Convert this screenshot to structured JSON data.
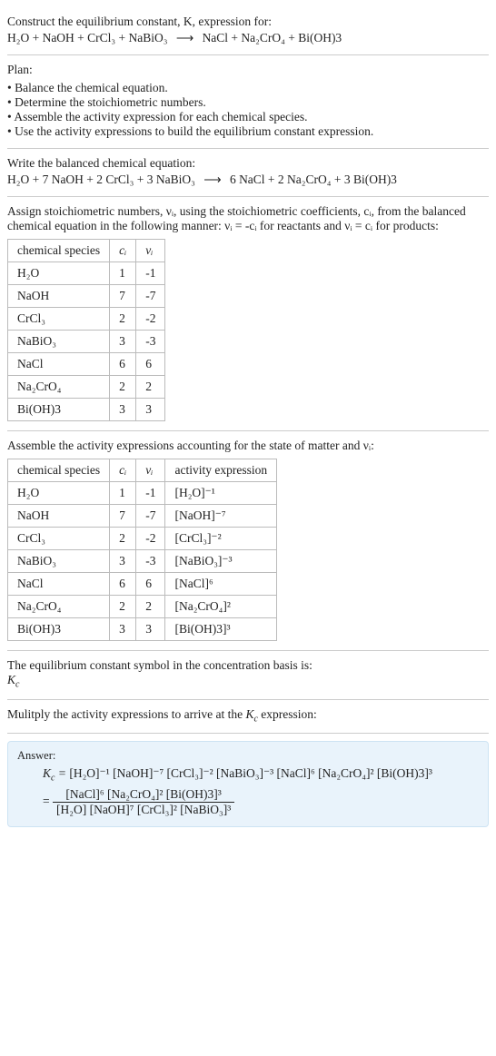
{
  "intro": {
    "line1": "Construct the equilibrium constant, K, expression for:",
    "reaction_lhs": "H₂O + NaOH + CrCl₃ + NaBiO₃",
    "arrow": "⟶",
    "reaction_rhs": "NaCl + Na₂CrO₄ + Bi(OH)3"
  },
  "plan": {
    "title": "Plan:",
    "items": [
      "Balance the chemical equation.",
      "Determine the stoichiometric numbers.",
      "Assemble the activity expression for each chemical species.",
      "Use the activity expressions to build the equilibrium constant expression."
    ]
  },
  "balanced": {
    "title": "Write the balanced chemical equation:",
    "lhs": "H₂O + 7 NaOH + 2 CrCl₃ + 3 NaBiO₃",
    "arrow": "⟶",
    "rhs": "6 NaCl + 2 Na₂CrO₄ + 3 Bi(OH)3"
  },
  "stoich": {
    "intro1": "Assign stoichiometric numbers, νᵢ, using the stoichiometric coefficients, cᵢ, from the balanced chemical equation in the following manner: νᵢ = -cᵢ for reactants and νᵢ = cᵢ for products:",
    "headers": [
      "chemical species",
      "cᵢ",
      "νᵢ"
    ],
    "rows": [
      {
        "s": "H₂O",
        "c": "1",
        "v": "-1"
      },
      {
        "s": "NaOH",
        "c": "7",
        "v": "-7"
      },
      {
        "s": "CrCl₃",
        "c": "2",
        "v": "-2"
      },
      {
        "s": "NaBiO₃",
        "c": "3",
        "v": "-3"
      },
      {
        "s": "NaCl",
        "c": "6",
        "v": "6"
      },
      {
        "s": "Na₂CrO₄",
        "c": "2",
        "v": "2"
      },
      {
        "s": "Bi(OH)3",
        "c": "3",
        "v": "3"
      }
    ]
  },
  "activity": {
    "intro": "Assemble the activity expressions accounting for the state of matter and νᵢ:",
    "headers": [
      "chemical species",
      "cᵢ",
      "νᵢ",
      "activity expression"
    ],
    "rows": [
      {
        "s": "H₂O",
        "c": "1",
        "v": "-1",
        "a": "[H₂O]⁻¹"
      },
      {
        "s": "NaOH",
        "c": "7",
        "v": "-7",
        "a": "[NaOH]⁻⁷"
      },
      {
        "s": "CrCl₃",
        "c": "2",
        "v": "-2",
        "a": "[CrCl₃]⁻²"
      },
      {
        "s": "NaBiO₃",
        "c": "3",
        "v": "-3",
        "a": "[NaBiO₃]⁻³"
      },
      {
        "s": "NaCl",
        "c": "6",
        "v": "6",
        "a": "[NaCl]⁶"
      },
      {
        "s": "Na₂CrO₄",
        "c": "2",
        "v": "2",
        "a": "[Na₂CrO₄]²"
      },
      {
        "s": "Bi(OH)3",
        "c": "3",
        "v": "3",
        "a": "[Bi(OH)3]³"
      }
    ]
  },
  "kc_symbol": {
    "line1": "The equilibrium constant symbol in the concentration basis is:",
    "symbol": "K_c"
  },
  "multiply": {
    "line": "Mulitply the activity expressions to arrive at the K_c expression:"
  },
  "answer": {
    "label": "Answer:",
    "kc_eq": "K_c =",
    "product": "[H₂O]⁻¹ [NaOH]⁻⁷ [CrCl₃]⁻² [NaBiO₃]⁻³ [NaCl]⁶ [Na₂CrO₄]² [Bi(OH)3]³",
    "eq2": "=",
    "num": "[NaCl]⁶ [Na₂CrO₄]² [Bi(OH)3]³",
    "den": "[H₂O] [NaOH]⁷ [CrCl₃]² [NaBiO₃]³"
  },
  "chart_data": {
    "type": "table",
    "tables": [
      {
        "title": "Stoichiometric numbers",
        "columns": [
          "chemical species",
          "cᵢ",
          "νᵢ"
        ],
        "rows": [
          [
            "H₂O",
            1,
            -1
          ],
          [
            "NaOH",
            7,
            -7
          ],
          [
            "CrCl₃",
            2,
            -2
          ],
          [
            "NaBiO₃",
            3,
            -3
          ],
          [
            "NaCl",
            6,
            6
          ],
          [
            "Na₂CrO₄",
            2,
            2
          ],
          [
            "Bi(OH)3",
            3,
            3
          ]
        ]
      },
      {
        "title": "Activity expressions",
        "columns": [
          "chemical species",
          "cᵢ",
          "νᵢ",
          "activity expression"
        ],
        "rows": [
          [
            "H₂O",
            1,
            -1,
            "[H₂O]⁻¹"
          ],
          [
            "NaOH",
            7,
            -7,
            "[NaOH]⁻⁷"
          ],
          [
            "CrCl₃",
            2,
            -2,
            "[CrCl₃]⁻²"
          ],
          [
            "NaBiO₃",
            3,
            -3,
            "[NaBiO₃]⁻³"
          ],
          [
            "NaCl",
            6,
            6,
            "[NaCl]⁶"
          ],
          [
            "Na₂CrO₄",
            2,
            2,
            "[Na₂CrO₄]²"
          ],
          [
            "Bi(OH)3",
            3,
            3,
            "[Bi(OH)3]³"
          ]
        ]
      }
    ]
  }
}
